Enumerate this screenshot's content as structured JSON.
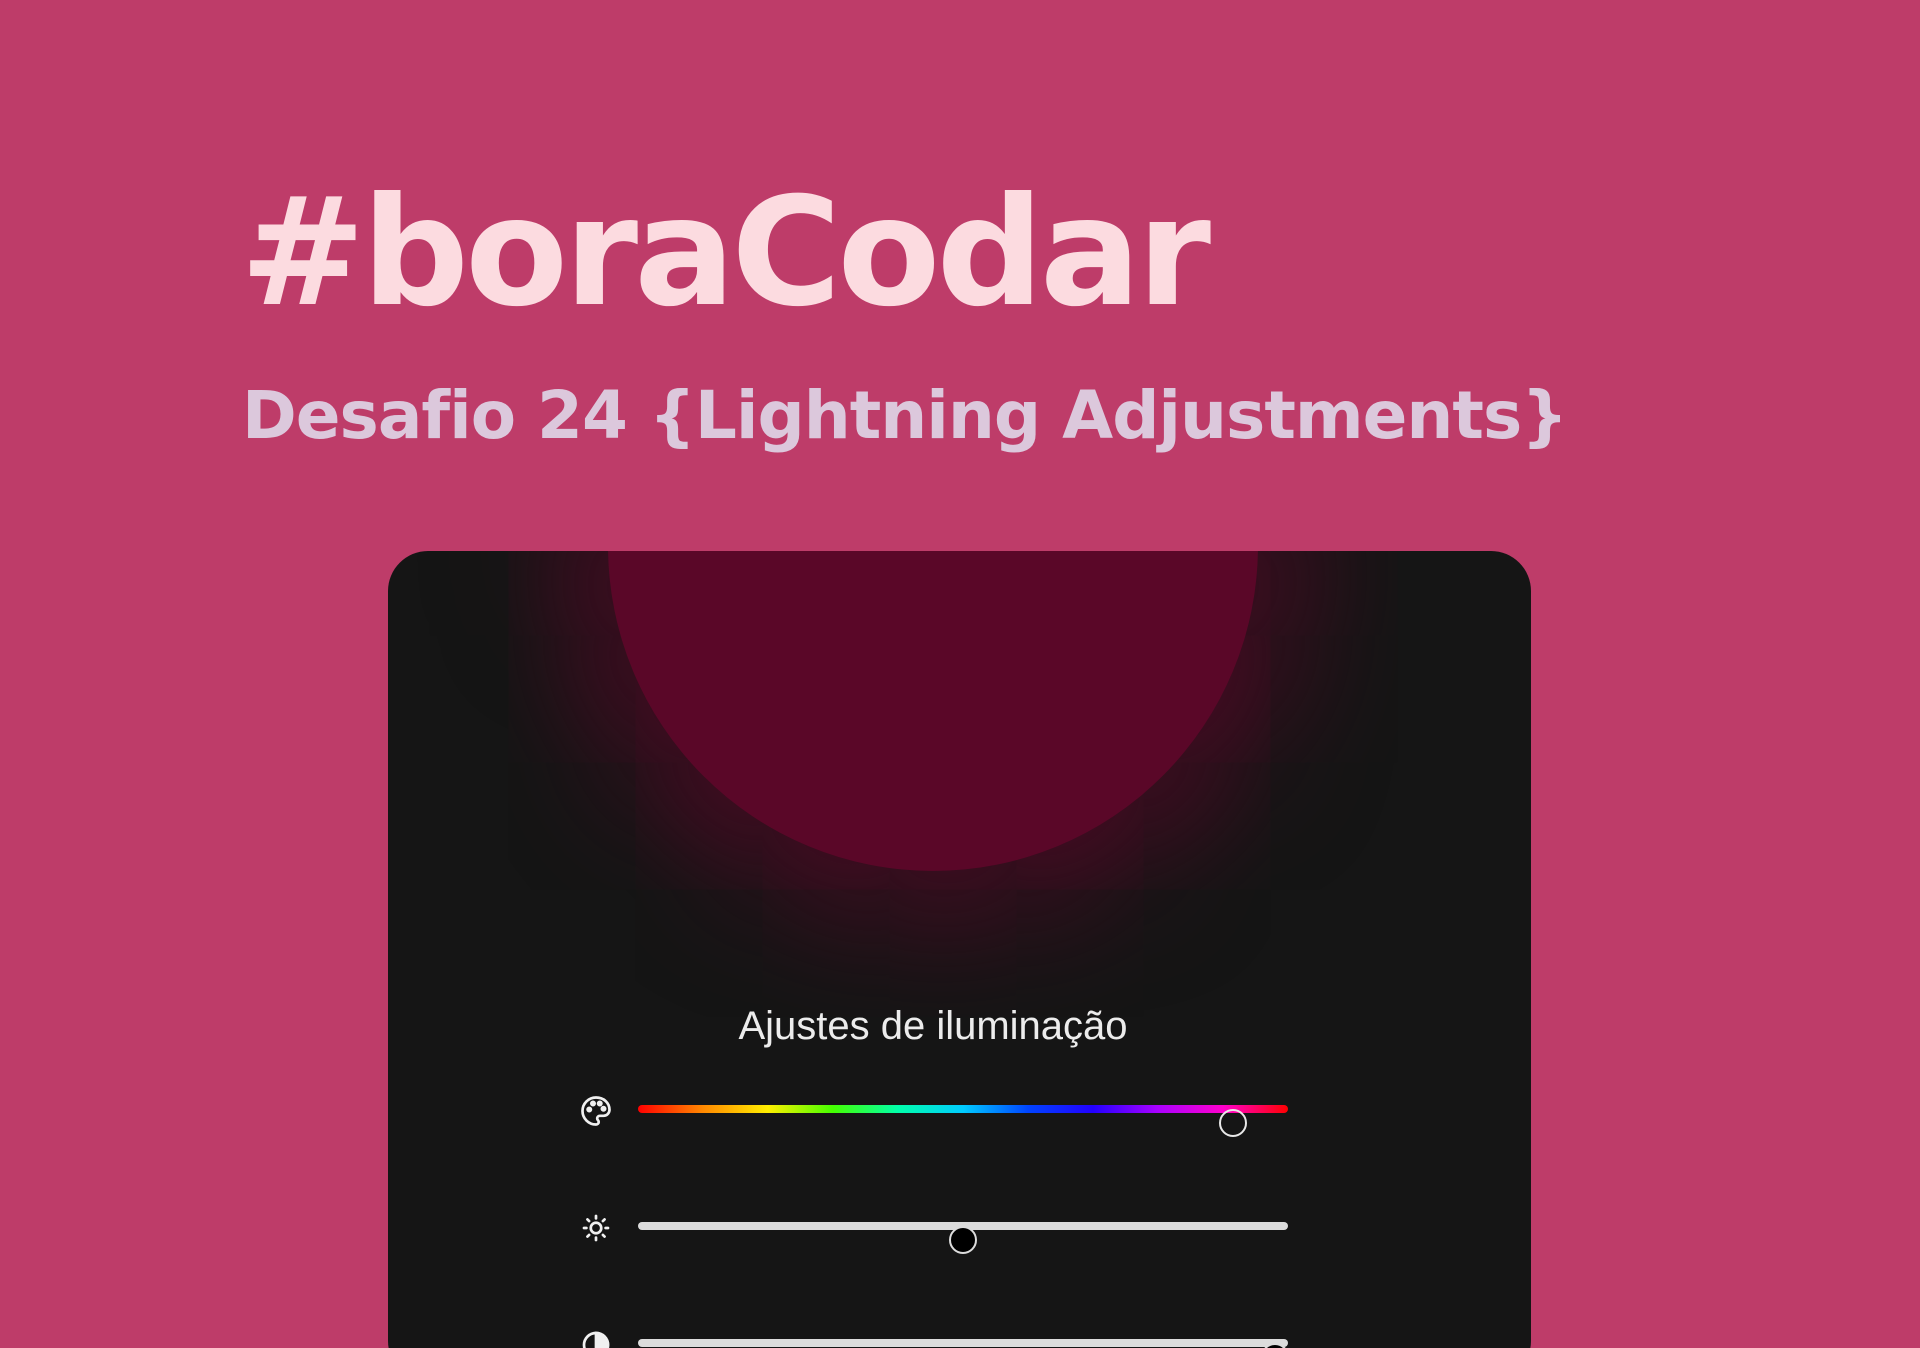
{
  "header": {
    "title": "#boraCodar",
    "subtitle": "Desafio 24 {Lightning Adjustments}"
  },
  "card": {
    "title": "Ajustes de iluminação",
    "controls": [
      {
        "icon": "palette-icon",
        "kind": "hue",
        "value_fraction": 0.915
      },
      {
        "icon": "brightness-icon",
        "kind": "brightness",
        "value_fraction": 0.5
      },
      {
        "icon": "contrast-icon",
        "kind": "intensity",
        "value_fraction": 0.98
      }
    ]
  },
  "colors": {
    "page_background": "#be3c69",
    "title": "#fcdbe0",
    "subtitle": "#dcc8dc",
    "card_background": "#151515",
    "glow": "#5a0728"
  }
}
